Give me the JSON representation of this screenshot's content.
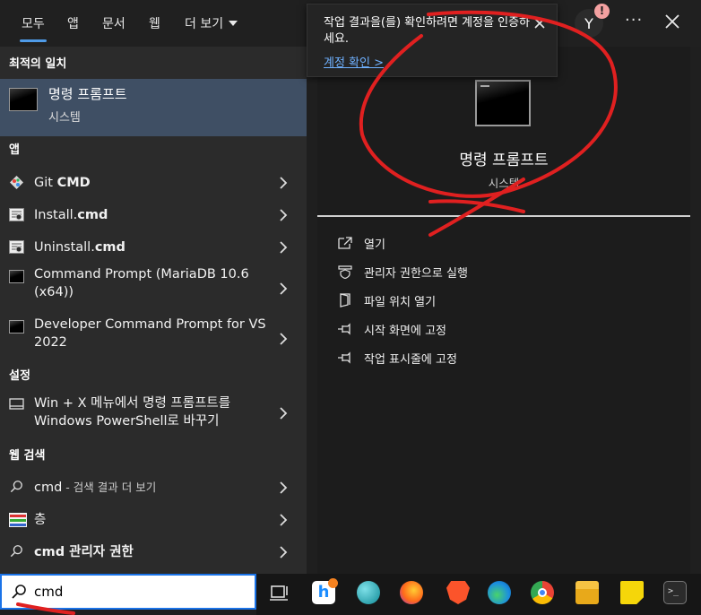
{
  "tabs": [
    {
      "label": "모두",
      "active": true
    },
    {
      "label": "앱"
    },
    {
      "label": "문서"
    },
    {
      "label": "웹"
    },
    {
      "label": "더 보기"
    }
  ],
  "avatar_letter": "Y",
  "badge": "!",
  "more_label": "···",
  "sections": {
    "best_match": "최적의 일치",
    "apps": "앱",
    "settings": "설정",
    "web_search": "웹 검색"
  },
  "best_match": {
    "title": "명령 프롬프트",
    "subtitle": "시스템"
  },
  "apps": [
    {
      "prefix": "Git ",
      "bold": "CMD",
      "icon": "git-icon"
    },
    {
      "prefix": "Install.",
      "bold": "cmd",
      "icon": "cmd-script-icon"
    },
    {
      "prefix": "Uninstall.",
      "bold": "cmd",
      "icon": "cmd-script-icon"
    },
    {
      "prefix": "Command Prompt (MariaDB 10.6 (x64))",
      "bold": "",
      "icon": "console-icon"
    },
    {
      "prefix": "Developer Command Prompt for VS 2022",
      "bold": "",
      "icon": "console-icon"
    }
  ],
  "settings_item": "Win + X 메뉴에서 명령 프롬프트를 Windows PowerShell로 바꾸기",
  "web_items": [
    {
      "main": "cmd",
      "suffix": " - 검색 결과 더 보기"
    },
    {
      "main": "층",
      "suffix": ""
    },
    {
      "main": "cmd 관리자 권한",
      "suffix": ""
    }
  ],
  "search": {
    "value": "cmd"
  },
  "detail": {
    "title": "명령 프롬프트",
    "subtitle": "시스템",
    "actions": [
      "열기",
      "관리자 권한으로 실행",
      "파일 위치 열기",
      "시작 화면에 고정",
      "작업 표시줄에 고정"
    ]
  },
  "toast": {
    "message": "작업 결과을(를) 확인하려면 계정을 인증하세요.",
    "link": "계정 확인 >"
  },
  "colors": {
    "accent": "#4f9be8",
    "selection": "#3f4f64",
    "ink": "#e02020"
  }
}
